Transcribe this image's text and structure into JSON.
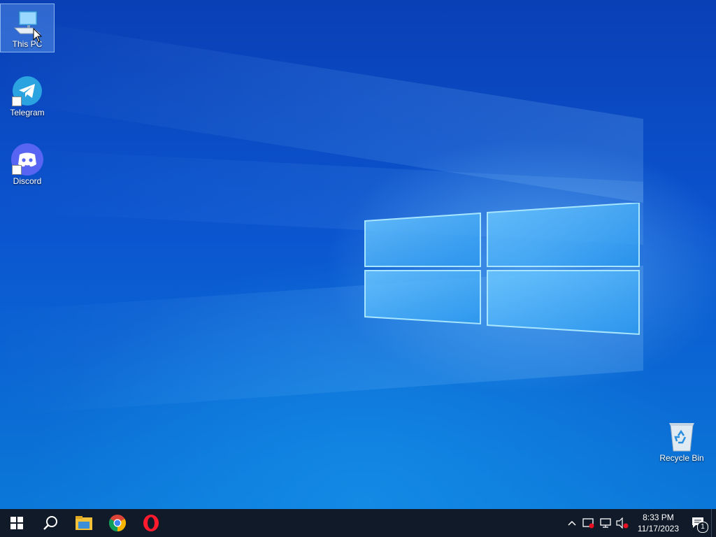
{
  "desktop": {
    "icons": [
      {
        "label": "This PC"
      },
      {
        "label": "Telegram"
      },
      {
        "label": "Discord"
      },
      {
        "label": "Recycle Bin"
      }
    ]
  },
  "taskbar": {
    "start_icon": "windows-start-icon",
    "search_icon": "search-icon",
    "pinned": [
      {
        "name": "file-explorer-icon"
      },
      {
        "name": "chrome-icon"
      },
      {
        "name": "opera-icon"
      }
    ],
    "tray": {
      "time": "8:33 PM",
      "date": "11/17/2023",
      "notification_count": "1"
    }
  },
  "colors": {
    "taskbar": "#101a28",
    "desktop_blue": "#0b55cf",
    "accent": "#33bbff"
  }
}
